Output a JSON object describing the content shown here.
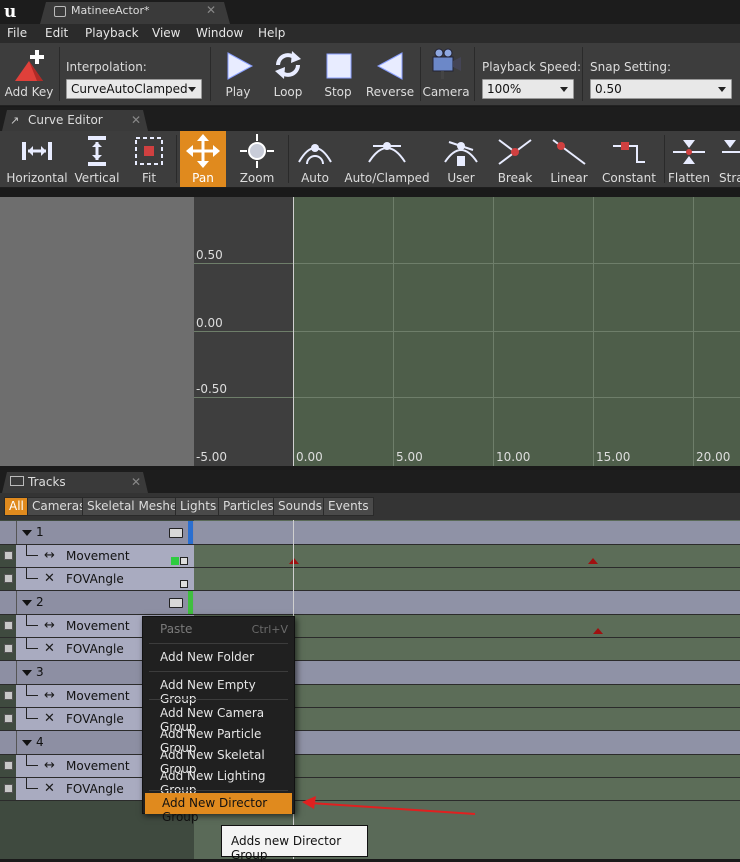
{
  "window": {
    "tab_title": "MatineeActor*"
  },
  "menu": [
    "File",
    "Edit",
    "Playback",
    "View",
    "Window",
    "Help"
  ],
  "toolbar": {
    "add_key": "Add Key",
    "interpolation_label": "Interpolation:",
    "interpolation_value": "CurveAutoClamped",
    "play": "Play",
    "loop": "Loop",
    "stop": "Stop",
    "reverse": "Reverse",
    "camera": "Camera",
    "playback_speed_label": "Playback Speed:",
    "playback_speed_value": "100%",
    "snap_label": "Snap Setting:",
    "snap_value": "0.50"
  },
  "curve_editor": {
    "tab_label": "Curve Editor",
    "buttons": [
      "Horizontal",
      "Vertical",
      "Fit",
      "Pan",
      "Zoom",
      "Auto",
      "Auto/Clamped",
      "User",
      "Break",
      "Linear",
      "Constant",
      "Flatten",
      "Stra"
    ],
    "active_button": "Pan",
    "y_labels": [
      "0.50",
      "0.00",
      "-0.50",
      "-5.00"
    ],
    "x_labels": [
      "0.00",
      "5.00",
      "10.00",
      "15.00",
      "20.00"
    ]
  },
  "tracks": {
    "tab_label": "Tracks",
    "filters": [
      "All",
      "Cameras",
      "Skeletal Meshes",
      "Lights",
      "Particles",
      "Sounds",
      "Events"
    ],
    "active_filter": "All",
    "groups": [
      {
        "name": "1",
        "tracks": [
          "Movement",
          "FOVAngle"
        ]
      },
      {
        "name": "2",
        "tracks": [
          "Movement",
          "FOVAngle"
        ]
      },
      {
        "name": "3",
        "tracks": [
          "Movement",
          "FOVAngle"
        ]
      },
      {
        "name": "4",
        "tracks": [
          "Movement",
          "FOVAngle"
        ]
      }
    ]
  },
  "context_menu": {
    "paste": "Paste",
    "paste_shortcut": "Ctrl+V",
    "add_folder": "Add New Folder",
    "add_empty_group": "Add New Empty Group",
    "add_camera_group": "Add New Camera Group",
    "add_particle_group": "Add New Particle Group",
    "add_skeletal_group": "Add New Skeletal Group",
    "add_lighting_group": "Add New Lighting Group",
    "add_director_group": "Add New Director Group"
  },
  "tooltip": "Adds new Director Group",
  "colors": {
    "accent": "#e08a1e",
    "group_blue": "#2a6fd0",
    "group_green": "#3fbf3f",
    "key_marker": "#a01010"
  }
}
